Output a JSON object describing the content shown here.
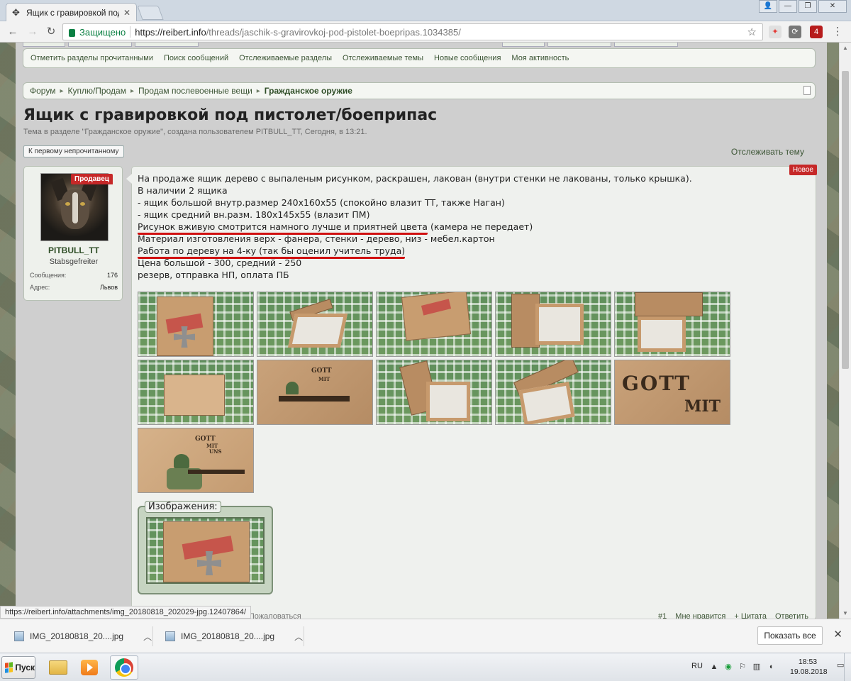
{
  "browser": {
    "tab_title": "Ящик с гравировкой под",
    "tab_icon": "puzzle-icon",
    "secure_label": "Защищено",
    "url_host": "https://reibert.info",
    "url_path": "/threads/jaschik-s-gravirovkoj-pod-pistolet-boepripas.1034385/",
    "ext_badge": "4"
  },
  "subnav": {
    "items": [
      "Отметить разделы прочитанными",
      "Поиск сообщений",
      "Отслеживаемые разделы",
      "Отслеживаемые темы",
      "Новые сообщения",
      "Моя активность"
    ]
  },
  "breadcrumb": {
    "items": [
      "Форум",
      "Куплю/Продам",
      "Продам послевоенные вещи"
    ],
    "separator": "▸",
    "current": "Гражданское оружие"
  },
  "thread": {
    "title": "Ящик с гравировкой под пистолет/боеприпас",
    "subtitle": "Тема в разделе \"Гражданское оружие\", создана пользователем PITBULL_TT, Сегодня, в 13:21.",
    "first_unread": "К первому непрочитанному",
    "watch": "Отслеживать тему"
  },
  "user": {
    "badge": "Продавец",
    "name": "PITBULL_TT",
    "title": "Stabsgefreiter",
    "messages_label": "Сообщения:",
    "messages_value": "176",
    "address_label": "Адрес:",
    "address_value": "Львов"
  },
  "post": {
    "new_badge": "Новое",
    "lines": [
      "На продаже ящик дерево с выпаленым рисунком, раскрашен, лакован (внутри стенки не лакованы, только крышка).",
      "В наличии 2 ящика",
      "- ящик большой внутр.размер 240х160х55 (спокойно влазит ТТ, также Наган)",
      "- ящик средний вн.разм. 180х145х55 (влазит ПМ)"
    ],
    "line5_underlined": "Рисунок вживую смотрится намного лучше и приятней цвета",
    "line5_rest": " (камера не передает)",
    "line6": "Материал изготовления верх - фанера, стенки - дерево, низ - мебел.картон",
    "line7_underlined": "Работа по дереву на 4-ку (так бы оценил учитель труда)",
    "lines_after": [
      "Цена большой - 300, средний - 250",
      "резерв, отправка НП, оплата ПБ"
    ],
    "thumb_text_gott": "GOTT",
    "thumb_text_mit": "MIT",
    "thumb_text_uns": "UNS",
    "attachments_label": "Изображения:",
    "footer_left": "PITBULL_TT, Сегодня, в 13:21   Пожаловаться",
    "post_number": "#1",
    "like": "Мне нравится",
    "quote": "+ Цитата",
    "reply": "Ответить"
  },
  "status_url": "https://reibert.info/attachments/img_20180818_202029-jpg.12407864/",
  "downloads": {
    "items": [
      "IMG_20180818_20....jpg",
      "IMG_20180818_20....jpg"
    ],
    "show_all": "Показать все"
  },
  "taskbar": {
    "start": "Пуск",
    "lang": "RU",
    "time": "18:53",
    "date": "19.08.2018"
  },
  "colors": {
    "accent_green": "#3c5535",
    "badge_red": "#c62828",
    "secure_green": "#0b8043"
  }
}
